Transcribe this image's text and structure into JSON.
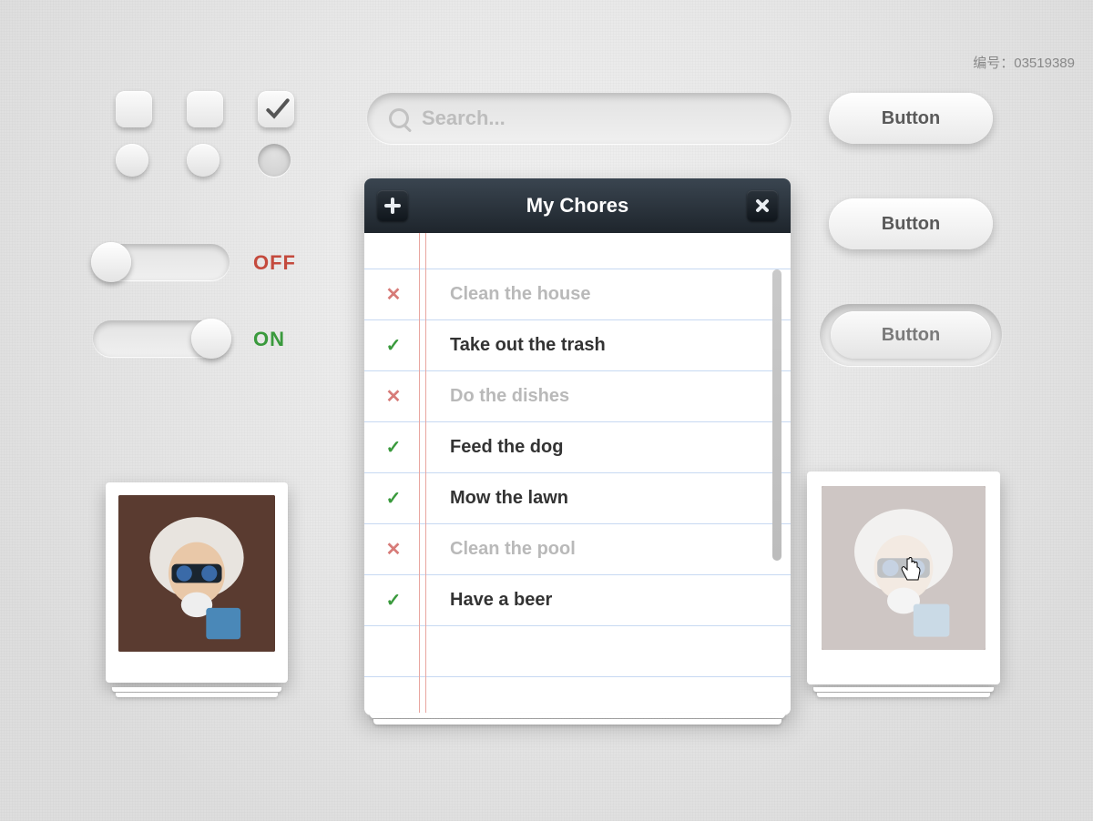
{
  "meta": {
    "id_label": "编号：03519389"
  },
  "search": {
    "placeholder": "Search..."
  },
  "buttons": {
    "b1": "Button",
    "b2": "Button",
    "b3": "Button"
  },
  "toggles": {
    "off_label": "OFF",
    "on_label": "ON"
  },
  "card": {
    "title": "My Chores",
    "items": [
      {
        "mark": "✕",
        "done": false,
        "text": "Clean the house"
      },
      {
        "mark": "✓",
        "done": true,
        "text": "Take out the trash"
      },
      {
        "mark": "✕",
        "done": false,
        "text": "Do the dishes"
      },
      {
        "mark": "✓",
        "done": true,
        "text": "Feed the dog"
      },
      {
        "mark": "✓",
        "done": true,
        "text": "Mow the lawn"
      },
      {
        "mark": "✕",
        "done": false,
        "text": "Clean the pool"
      },
      {
        "mark": "✓",
        "done": true,
        "text": "Have a beer"
      }
    ]
  }
}
